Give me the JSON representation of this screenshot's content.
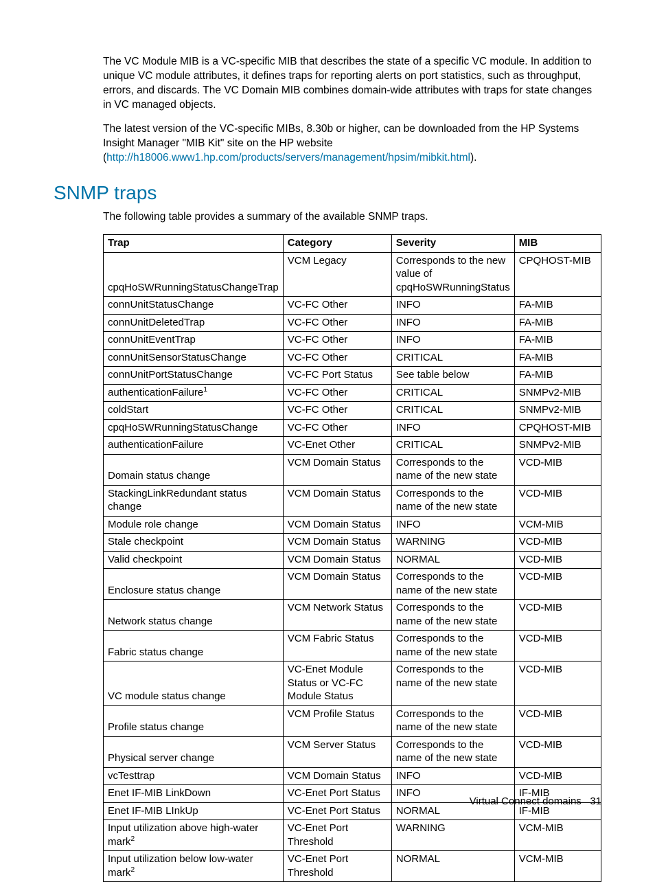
{
  "para1": "The VC Module MIB is a VC-specific MIB that describes the state of a specific VC module. In addition to unique VC module attributes, it defines traps for reporting alerts on port statistics, such as throughput, errors, and discards. The VC Domain MIB combines domain-wide attributes with traps for state changes in VC managed objects.",
  "para2_a": "The latest version of the VC-specific MIBs, 8.30b or higher, can be downloaded from the HP Systems Insight Manager \"MIB Kit\" site on the HP website (",
  "para2_link": "http://h18006.www1.hp.com/products/servers/management/hpsim/mibkit.html",
  "para2_b": ").",
  "heading": "SNMP traps",
  "intro": "The following table provides a summary of the available SNMP traps.",
  "headers": {
    "trap": "Trap",
    "category": "Category",
    "severity": "Severity",
    "mib": "MIB"
  },
  "rows": [
    {
      "trap": "cpqHoSWRunningStatusChangeTrap",
      "sup": "",
      "category": "VCM Legacy",
      "severity": "Corresponds to the new value of cpqHoSWRunningStatus",
      "mib": "CPQHOST-MIB"
    },
    {
      "trap": "connUnitStatusChange",
      "sup": "",
      "category": "VC-FC Other",
      "severity": "INFO",
      "mib": "FA-MIB"
    },
    {
      "trap": "connUnitDeletedTrap",
      "sup": "",
      "category": "VC-FC Other",
      "severity": "INFO",
      "mib": "FA-MIB"
    },
    {
      "trap": "connUnitEventTrap",
      "sup": "",
      "category": "VC-FC Other",
      "severity": "INFO",
      "mib": "FA-MIB"
    },
    {
      "trap": "connUnitSensorStatusChange",
      "sup": "",
      "category": "VC-FC Other",
      "severity": "CRITICAL",
      "mib": "FA-MIB"
    },
    {
      "trap": "connUnitPortStatusChange",
      "sup": "",
      "category": "VC-FC Port Status",
      "severity": "See table below",
      "mib": "FA-MIB"
    },
    {
      "trap": "authenticationFailure",
      "sup": "1",
      "category": "VC-FC Other",
      "severity": "CRITICAL",
      "mib": "SNMPv2-MIB"
    },
    {
      "trap": "coldStart",
      "sup": "",
      "category": "VC-FC Other",
      "severity": "CRITICAL",
      "mib": "SNMPv2-MIB"
    },
    {
      "trap": "cpqHoSWRunningStatusChange",
      "sup": "",
      "category": "VC-FC Other",
      "severity": "INFO",
      "mib": "CPQHOST-MIB"
    },
    {
      "trap": "authenticationFailure",
      "sup": "",
      "category": "VC-Enet Other",
      "severity": "CRITICAL",
      "mib": "SNMPv2-MIB"
    },
    {
      "trap": "Domain status change",
      "sup": "",
      "category": "VCM Domain Status",
      "severity": "Corresponds to the name of the new state",
      "mib": "VCD-MIB"
    },
    {
      "trap": "StackingLinkRedundant status change",
      "sup": "",
      "category": "VCM Domain Status",
      "severity": "Corresponds to the name of the new state",
      "mib": "VCD-MIB"
    },
    {
      "trap": "Module role change",
      "sup": "",
      "category": "VCM Domain Status",
      "severity": "INFO",
      "mib": "VCM-MIB"
    },
    {
      "trap": "Stale checkpoint",
      "sup": "",
      "category": "VCM Domain Status",
      "severity": "WARNING",
      "mib": "VCD-MIB"
    },
    {
      "trap": "Valid checkpoint",
      "sup": "",
      "category": "VCM Domain Status",
      "severity": "NORMAL",
      "mib": "VCD-MIB"
    },
    {
      "trap": "Enclosure status change",
      "sup": "",
      "category": "VCM Domain Status",
      "severity": "Corresponds to the name of the new state",
      "mib": "VCD-MIB"
    },
    {
      "trap": "Network status change",
      "sup": "",
      "category": "VCM Network Status",
      "severity": "Corresponds to the name of the new state",
      "mib": "VCD-MIB"
    },
    {
      "trap": "Fabric status change",
      "sup": "",
      "category": "VCM Fabric Status",
      "severity": "Corresponds to the name of the new state",
      "mib": "VCD-MIB"
    },
    {
      "trap": "VC module status change",
      "sup": "",
      "category": "VC-Enet Module Status or VC-FC Module Status",
      "severity": "Corresponds to the name of the new state",
      "mib": "VCD-MIB"
    },
    {
      "trap": "Profile status change",
      "sup": "",
      "category": "VCM Profile Status",
      "severity": "Corresponds to the name of the new state",
      "mib": "VCD-MIB"
    },
    {
      "trap": "Physical server change",
      "sup": "",
      "category": "VCM Server Status",
      "severity": "Corresponds to the name of the new state",
      "mib": "VCD-MIB"
    },
    {
      "trap": "vcTesttrap",
      "sup": "",
      "category": "VCM Domain Status",
      "severity": "INFO",
      "mib": "VCD-MIB"
    },
    {
      "trap": "Enet IF-MIB LinkDown",
      "sup": "",
      "category": "VC-Enet Port Status",
      "severity": "INFO",
      "mib": "IF-MIB"
    },
    {
      "trap": "Enet IF-MIB LInkUp",
      "sup": "",
      "category": "VC-Enet Port Status",
      "severity": "NORMAL",
      "mib": "IF-MIB"
    },
    {
      "trap": "Input utilization above high-water mark",
      "sup": "2",
      "category": "VC-Enet Port Threshold",
      "severity": "WARNING",
      "mib": "VCM-MIB"
    },
    {
      "trap": "Input utilization below low-water mark",
      "sup": "2",
      "category": "VC-Enet Port Threshold",
      "severity": "NORMAL",
      "mib": "VCM-MIB"
    }
  ],
  "footer": {
    "text": "Virtual Connect domains",
    "page": "31"
  }
}
